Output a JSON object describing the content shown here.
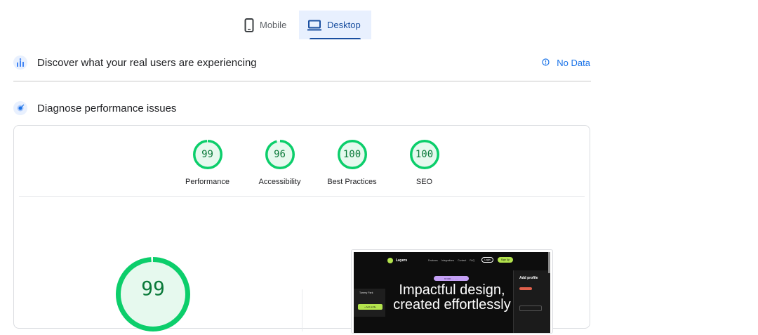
{
  "tabs": [
    {
      "label": "Mobile",
      "icon": "phone-icon",
      "selected": false
    },
    {
      "label": "Desktop",
      "icon": "laptop-icon",
      "selected": true
    }
  ],
  "field_section": {
    "title": "Discover what your real users are experiencing",
    "icon": "users-chart-icon",
    "status_label": "No Data",
    "status_icon": "info-icon"
  },
  "lab_section": {
    "title": "Diagnose performance issues",
    "icon": "target-icon"
  },
  "scores": [
    {
      "value": "99",
      "label": "Performance",
      "fraction": 0.99
    },
    {
      "value": "96",
      "label": "Accessibility",
      "fraction": 0.96
    },
    {
      "value": "100",
      "label": "Best Practices",
      "fraction": 1.0
    },
    {
      "value": "100",
      "label": "SEO",
      "fraction": 1.0
    }
  ],
  "main_score": {
    "value": "99",
    "fraction": 0.99
  },
  "colors": {
    "pass_ring": "#0cce6b",
    "pass_fill": "#e6f9ee",
    "pass_text": "#0b7a3a",
    "accent": "#1a73e8",
    "tab_active_bg": "#e8f0fe"
  },
  "thumbnail": {
    "brand": "Layers",
    "nav_links": [
      "Features",
      "Integrations",
      "Contact",
      "FAQ"
    ],
    "login_label": "Login",
    "signup_label": "Sign Up",
    "pill_text": "67,000 ···· ·····",
    "headline_line1": "Impactful design,",
    "headline_line2": "created effortlessly",
    "side_title": "Add profile",
    "card_name": "Tammy Park",
    "card_button": "+ Add profile"
  }
}
